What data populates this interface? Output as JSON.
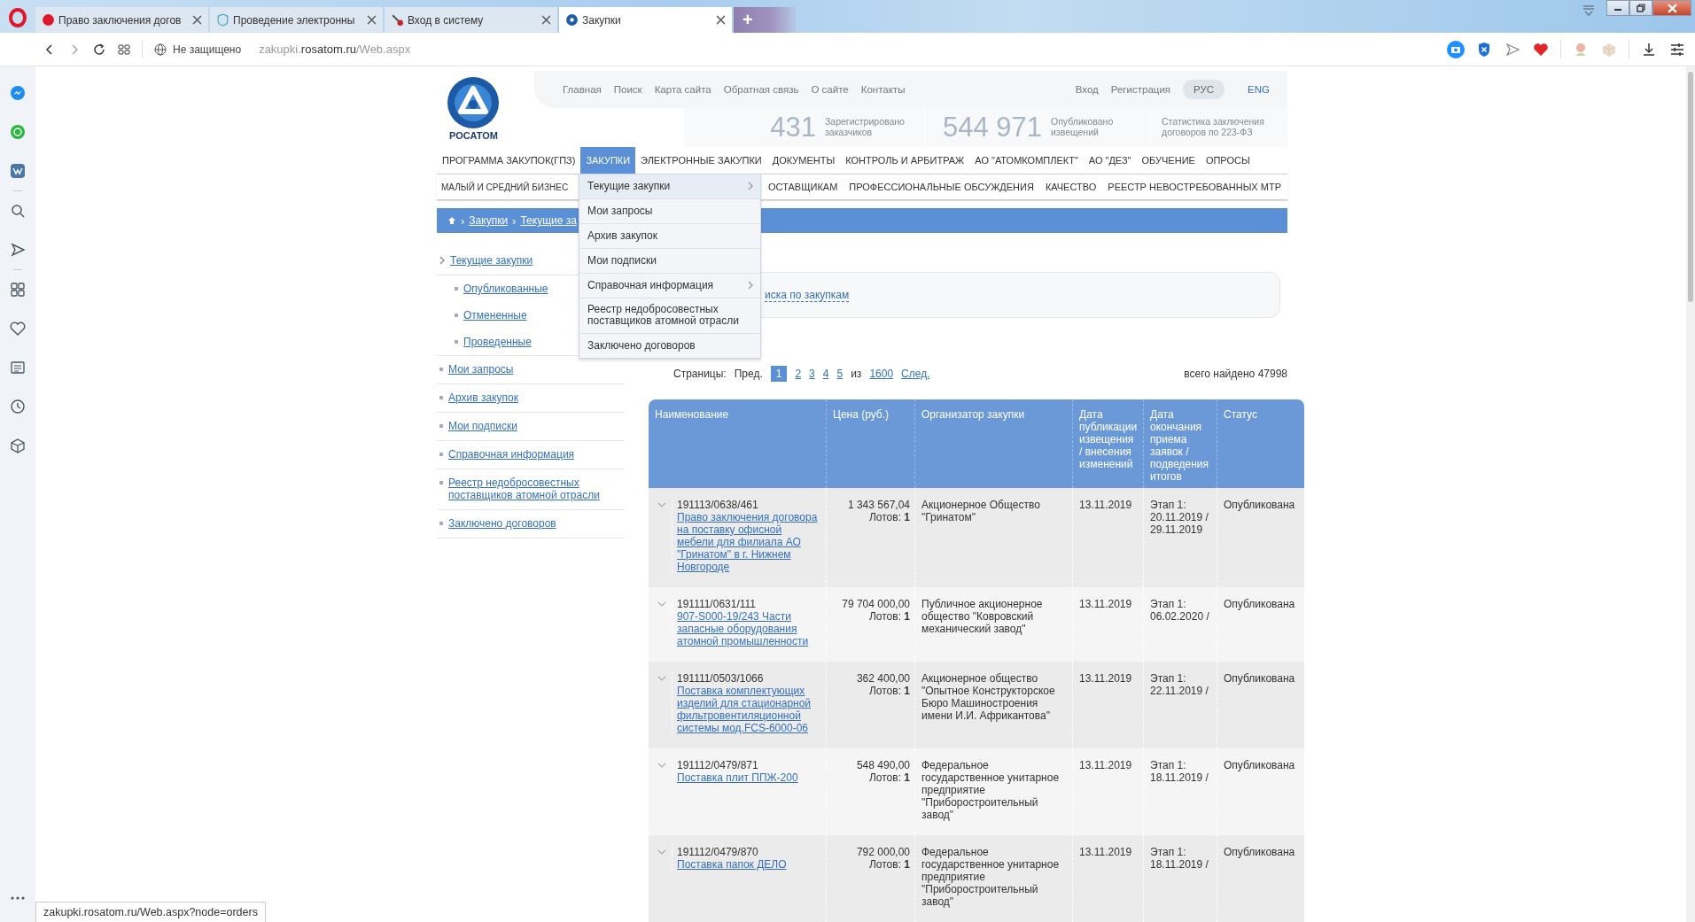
{
  "browser": {
    "tabs": [
      {
        "title": "Право заключения догов",
        "selected": false,
        "kind": "record"
      },
      {
        "title": "Проведение электронны",
        "selected": false,
        "kind": "shield"
      },
      {
        "title": "Вход в систему",
        "selected": false,
        "kind": "tool"
      },
      {
        "title": "Закупки",
        "selected": true,
        "kind": "atom"
      }
    ],
    "new_tab": "+",
    "address": {
      "security": "Не защищено",
      "url_prefix": "zakupki.",
      "url_host": "rosatom.ru",
      "url_path": "/Web.aspx"
    },
    "status_url": "zakupki.rosatom.ru/Web.aspx?node=orders"
  },
  "header": {
    "logo_text": "РОСАТОМ",
    "top_links": [
      "Главная",
      "Поиск",
      "Карта сайта",
      "Обратная связь",
      "О сайте",
      "Контакты"
    ],
    "auth_links": [
      "Вход",
      "Регистрация"
    ],
    "languages": [
      {
        "label": "РУС",
        "selected": true
      },
      {
        "label": "ENG",
        "selected": false
      }
    ],
    "stats": [
      {
        "value": "431",
        "label": "Зарегистрировано заказчиков"
      },
      {
        "value": "544 971",
        "label": "Опубликовано извещений"
      }
    ],
    "stats_link": "Статистика заключения договоров по 223-ФЗ"
  },
  "main_menu": [
    {
      "label": "ПРОГРАММА ЗАКУПОК(ГПЗ)",
      "selected": false
    },
    {
      "label": "ЗАКУПКИ",
      "selected": true
    },
    {
      "label": "ЭЛЕКТРОННЫЕ ЗАКУПКИ",
      "selected": false
    },
    {
      "label": "ДОКУМЕНТЫ",
      "selected": false
    },
    {
      "label": "КОНТРОЛЬ И АРБИТРАЖ",
      "selected": false
    },
    {
      "label": "АО \"АТОМКОМПЛЕКТ\"",
      "selected": false
    },
    {
      "label": "АО \"ДЕЗ\"",
      "selected": false
    },
    {
      "label": "ОБУЧЕНИЕ",
      "selected": false
    },
    {
      "label": "ОПРОСЫ",
      "selected": false
    }
  ],
  "second_menu": [
    "МАЛЫЙ И СРЕДНИЙ БИЗНЕС",
    "ОСТАВЩИКАМ",
    "ПРОФЕССИОНАЛЬНЫЕ ОБСУЖДЕНИЯ",
    "КАЧЕСТВО",
    "РЕЕСТР НЕВОСТРЕБОВАННЫХ МТР"
  ],
  "dropdown": [
    {
      "label": "Текущие закупки",
      "has_submenu": true
    },
    {
      "label": "Мои запросы",
      "has_submenu": false
    },
    {
      "label": "Архив закупок",
      "has_submenu": false
    },
    {
      "label": "Мои подписки",
      "has_submenu": false
    },
    {
      "label": "Справочная информация",
      "has_submenu": true
    },
    {
      "label": "Реестр недобросовестных поставщиков атомной отрасли",
      "has_submenu": false
    },
    {
      "label": "Заключено договоров",
      "has_submenu": false
    }
  ],
  "breadcrumbs": [
    "Закупки",
    "Текущие за"
  ],
  "breadcrumb_separator": "›",
  "sidebar": [
    {
      "label": "Текущие закупки",
      "children": [
        {
          "label": "Опубликованные"
        },
        {
          "label": "Отмененные"
        },
        {
          "label": "Проведенные"
        }
      ]
    },
    {
      "label": "Мои запросы"
    },
    {
      "label": "Архив закупок"
    },
    {
      "label": "Мои подписки"
    },
    {
      "label": "Справочная информация"
    },
    {
      "label": "Реестр недобросовестных поставщиков атомной отрасли"
    },
    {
      "label": "Заключено договоров"
    }
  ],
  "search_link": "иска по закупкам",
  "pagination": {
    "label": "Страницы:",
    "prev": "Пред.",
    "pages": [
      {
        "label": "1",
        "selected": true
      },
      {
        "label": "2",
        "selected": false
      },
      {
        "label": "3",
        "selected": false
      },
      {
        "label": "4",
        "selected": false
      },
      {
        "label": "5",
        "selected": false
      }
    ],
    "of": "из",
    "last": "1600",
    "next": "След.",
    "total": "всего найдено 47998"
  },
  "table": {
    "columns": [
      "Наименование",
      "Цена (руб.)",
      "Организатор закупки",
      "Дата публикации извещения / внесения изменений",
      "Дата окончания приема заявок / подведения итогов",
      "Статус"
    ],
    "rows": [
      {
        "number": "191113/0638/461",
        "title": "Право заключения договора на поставку офисной мебели для филиала АО \"Гринатом\" в г. Нижнем Новгороде",
        "price": "1 343 567,04",
        "lots": "Лотов: **1**",
        "organizer": "Акционерное Общество \"Гринатом\"",
        "published": "13.11.2019",
        "deadline": "Этап 1: 20.11.2019 / 29.11.2019",
        "status": "Опубликована"
      },
      {
        "number": "191111/0631/111",
        "title": "907-S000-19/243 Части запасные оборудования атомной промышленности",
        "price": "79 704 000,00",
        "lots": "Лотов: **1**",
        "organizer": "Публичное акционерное общество \"Ковровский механический завод\"",
        "published": "13.11.2019",
        "deadline": "Этап 1: 06.02.2020 /",
        "status": "Опубликована"
      },
      {
        "number": "191111/0503/1066",
        "title": "Поставка комплектующих изделий для стационарной фильтровентиляционной системы мод.FCS-6000-06",
        "price": "362 400,00",
        "lots": "Лотов: **1**",
        "organizer": "Акционерное общество \"Опытное Конструкторское Бюро Машиностроения имени И.И. Африкантова\"",
        "published": "13.11.2019",
        "deadline": "Этап 1: 22.11.2019 /",
        "status": "Опубликована"
      },
      {
        "number": "191112/0479/871",
        "title": "Поставка плит ППЖ-200",
        "price": "548 490,00",
        "lots": "Лотов: **1**",
        "organizer": "Федеральное государственное унитарное предприятие \"Приборостроительный завод\"",
        "published": "13.11.2019",
        "deadline": "Этап 1: 18.11.2019 /",
        "status": "Опубликована"
      },
      {
        "number": "191112/0479/870",
        "title": "Поставка папок ДЕЛО",
        "price": "792 000,00",
        "lots": "Лотов: **1**",
        "organizer": "Федеральное государственное унитарное предприятие \"Приборостроительный завод\"",
        "published": "13.11.2019",
        "deadline": "Этап 1: 18.11.2019 /",
        "status": "Опубликована"
      }
    ]
  }
}
